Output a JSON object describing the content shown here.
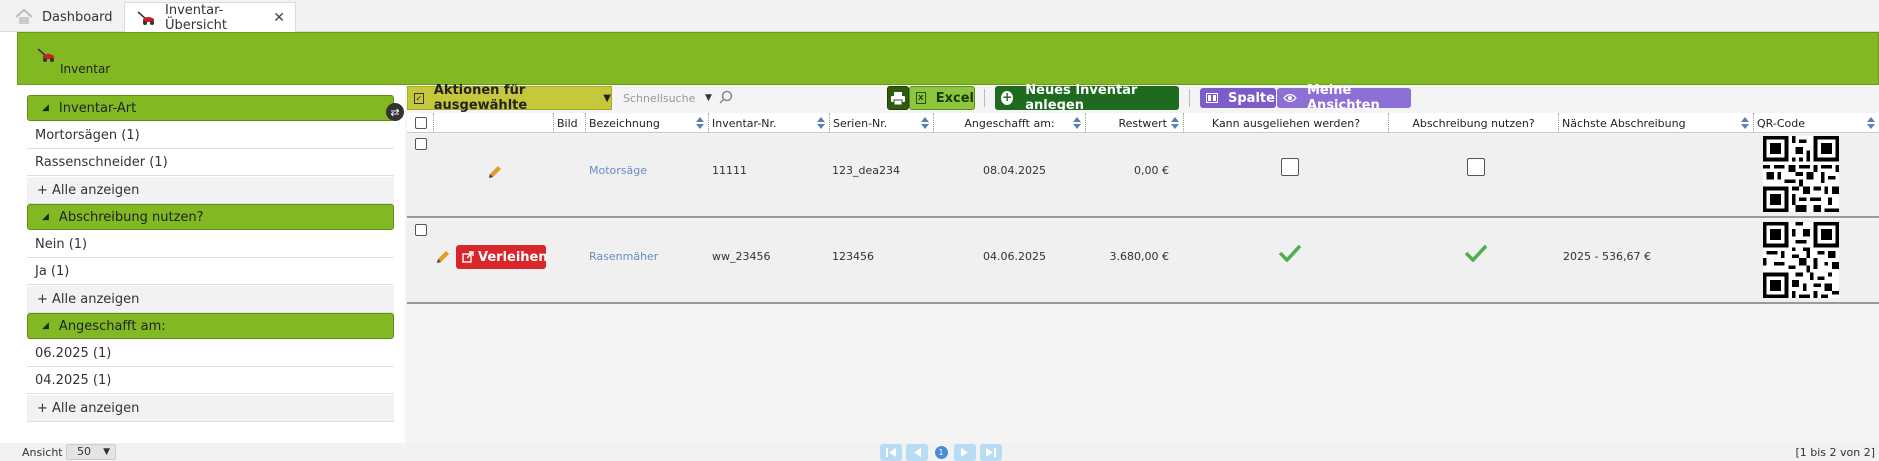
{
  "tabs": [
    {
      "label": "Dashboard",
      "icon": "home-icon"
    },
    {
      "label": "Inventar-Übersicht",
      "icon": "lawnmower-icon",
      "close": "✕"
    }
  ],
  "header": {
    "title": "Inventar"
  },
  "sidebar": {
    "facets": [
      {
        "title": "Inventar-Art",
        "items": [
          "Mortorsägen  (1)",
          "Rassenschneider  (1)"
        ],
        "more": "+ Alle anzeigen"
      },
      {
        "title": "Abschreibung nutzen?",
        "items": [
          "Nein  (1)",
          "Ja  (1)"
        ],
        "more": "+ Alle anzeigen"
      },
      {
        "title": "Angeschafft am:",
        "items": [
          "06.2025  (1)",
          "04.2025  (1)"
        ],
        "more": "+ Alle anzeigen"
      }
    ]
  },
  "toolbar": {
    "actions_label": "Aktionen für ausgewählte",
    "search_placeholder": "Schnellsuche",
    "excel_label": "Excel",
    "new_label": "Neues Inventar anlegen",
    "columns_label": "Spalten",
    "views_label": "Meine Ansichten"
  },
  "table": {
    "columns": [
      "Bild",
      "Bezeichnung",
      "Inventar-Nr.",
      "Serien-Nr.",
      "Angeschafft am:",
      "Restwert",
      "Kann ausgeliehen werden?",
      "Abschreibung nutzen?",
      "Nächste Abschreibung",
      "QR-Code"
    ],
    "rows": [
      {
        "name": "Motorsäge",
        "inv_nr": "11111",
        "serial": "123_dea234",
        "date": "08.04.2025",
        "value": "0,00 €",
        "lendable": false,
        "depreciation": false,
        "next_dep": "",
        "lend_button": ""
      },
      {
        "name": "Rasenmäher",
        "inv_nr": "ww_23456",
        "serial": "123456",
        "date": "04.06.2025",
        "value": "3.680,00 €",
        "lendable": true,
        "depreciation": true,
        "next_dep": "2025 - 536,67 €",
        "lend_button": "Verleihen"
      }
    ]
  },
  "footer": {
    "view_label": "Ansicht",
    "page_size": "50",
    "current_page": "1",
    "count": "[1 bis 2 von 2]"
  },
  "colors": {
    "brand_green": "#82b922",
    "danger": "#d9262a",
    "purple": "#7b5cc9",
    "dark_green": "#1e6a1e"
  }
}
